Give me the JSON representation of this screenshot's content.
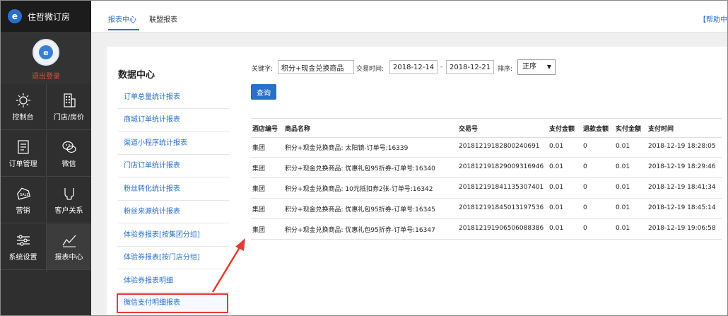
{
  "app": {
    "title": "住哲微订房",
    "logout": "退出登录"
  },
  "sidebar": {
    "items": [
      {
        "label": "控制台",
        "icon": "sun-icon"
      },
      {
        "label": "门店/房价",
        "icon": "building-icon"
      },
      {
        "label": "订单管理",
        "icon": "document-icon"
      },
      {
        "label": "微信",
        "icon": "wechat-icon"
      },
      {
        "label": "营销",
        "icon": "sale-tag-icon"
      },
      {
        "label": "客户关系",
        "icon": "glasses-icon"
      },
      {
        "label": "系统设置",
        "icon": "sliders-icon"
      },
      {
        "label": "报表中心",
        "icon": "line-chart-icon"
      }
    ]
  },
  "topbar": {
    "tabs": [
      "报表中心",
      "联盟报表"
    ],
    "help": "【帮助中"
  },
  "nav": {
    "title": "数据中心",
    "items": [
      "订单总量统计报表",
      "商城订单统计报表",
      "渠道小程序统计报表",
      "门店订单统计报表",
      "粉丝转化统计报表",
      "粉丝来源统计报表",
      "体验券报表[按集团分组]",
      "体验券报表[按门店分组]",
      "体验券报表明细",
      "微信支付明细报表"
    ]
  },
  "filters": {
    "keyword_label": "关键字:",
    "keyword_value": "积分+现金兑换商品",
    "time_label": "交易时间:",
    "date_from": "2018-12-14",
    "dash": "-",
    "date_to": "2018-12-21",
    "sort_label": "排序:",
    "sort_value": "正序",
    "query_button": "查询"
  },
  "table": {
    "headers": [
      "酒店编号",
      "商品名称",
      "交易号",
      "支付金额",
      "退款金额",
      "实付金额",
      "支付时间"
    ],
    "rows": [
      [
        "集团",
        "积分+现金兑换商品: 太阳镜-订单号:16339",
        "20181219182800240691",
        "0.01",
        "0",
        "0.01",
        "2018-12-19 18:28:05"
      ],
      [
        "集团",
        "积分+现金兑换商品: 优惠礼包95折券-订单号:16340",
        "201812191829009316946",
        "0.01",
        "0",
        "0.01",
        "2018-12-19 18:29:46"
      ],
      [
        "集团",
        "积分+现金兑换商品: 10元抵扣券2张-订单号:16342",
        "201812191841135307401",
        "0.01",
        "0",
        "0.01",
        "2018-12-19 18:41:34"
      ],
      [
        "集团",
        "积分+现金兑换商品: 优惠礼包95折券-订单号:16345",
        "201812191845013197536",
        "0.01",
        "0",
        "0.01",
        "2018-12-19 18:45:14"
      ],
      [
        "集团",
        "积分+现金兑换商品: 优惠礼包95折券-订单号:16347",
        "201812191906506088386",
        "0.01",
        "0",
        "0.01",
        "2018-12-19 19:06:58"
      ]
    ]
  },
  "colors": {
    "accent": "#2a6fc9",
    "sidebar": "#2f2f2f",
    "highlight": "#e53935",
    "logout": "#e04a3f"
  }
}
